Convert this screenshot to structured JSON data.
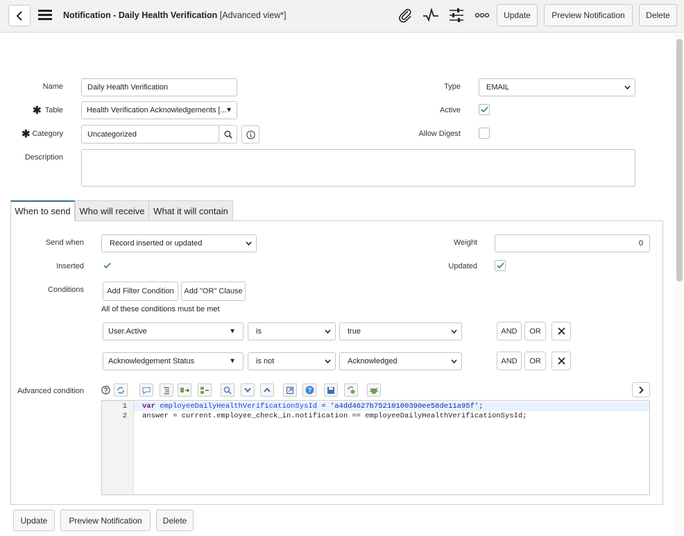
{
  "header": {
    "title": "Notification - Daily Health Verification",
    "view": "[Advanced view*]",
    "update": "Update",
    "preview": "Preview Notification",
    "delete": "Delete"
  },
  "form": {
    "name_label": "Name",
    "name_value": "Daily Health Verification",
    "table_label": "Table",
    "table_value": "Health Verification Acknowledgements [...",
    "category_label": "Category",
    "category_value": "Uncategorized",
    "description_label": "Description",
    "type_label": "Type",
    "type_value": "EMAIL",
    "active_label": "Active",
    "active": true,
    "digest_label": "Allow Digest",
    "allow_digest": false
  },
  "tabs": [
    "When to send",
    "Who will receive",
    "What it will contain"
  ],
  "when": {
    "send_when_label": "Send when",
    "send_when_value": "Record inserted or updated",
    "weight_label": "Weight",
    "weight_value": "0",
    "inserted_label": "Inserted",
    "updated_label": "Updated",
    "conditions_label": "Conditions",
    "add_filter": "Add Filter Condition",
    "add_or": "Add \"OR\" Clause",
    "all_met": "All of these conditions must be met",
    "rows": [
      {
        "field": "User.Active",
        "op": "is",
        "value": "true",
        "and": "AND",
        "or": "OR"
      },
      {
        "field": "Acknowledgement Status",
        "op": "is not",
        "value": "Acknowledged",
        "and": "AND",
        "or": "OR"
      }
    ],
    "advanced_label": "Advanced condition",
    "code": {
      "line1_no": "1",
      "line1_kw": "var",
      "line1_var": " employeeDailyHealthVerificationSysId",
      "line1_eq": " = ",
      "line1_str": "'a4dd4627b75210100390ee58de11a95f'",
      "line1_end": ";",
      "line2_no": "2",
      "line2": "answer = current.employee_check_in.notification == employeeDailyHealthVerificationSysId;"
    }
  },
  "footer": {
    "update": "Update",
    "preview": "Preview Notification",
    "delete": "Delete"
  }
}
